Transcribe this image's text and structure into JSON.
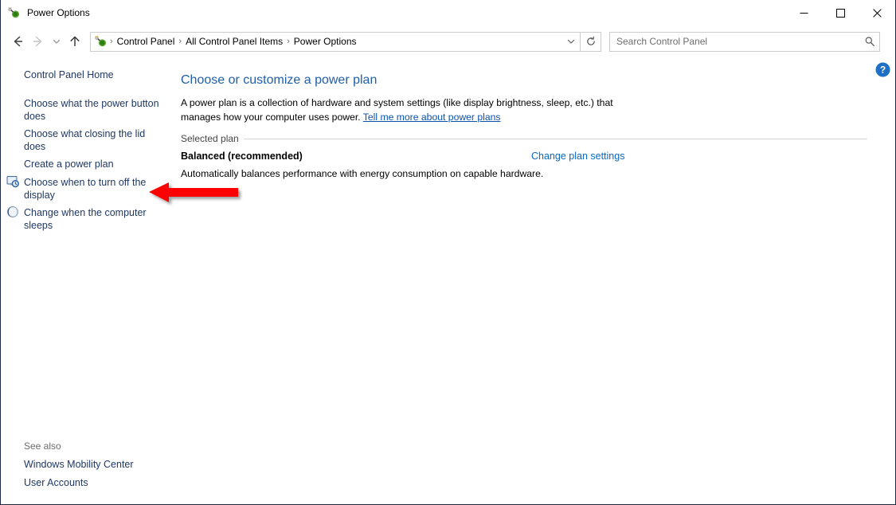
{
  "window": {
    "title": "Power Options",
    "icon": "power-plug-icon",
    "controls": {
      "minimize": "minimize-button",
      "maximize": "maximize-button",
      "close": "close-button"
    }
  },
  "navbar": {
    "back": "back-button",
    "forward": "forward-button",
    "recent": "recent-locations-button",
    "up": "up-button",
    "breadcrumb": {
      "icon": "power-plug-icon",
      "items": [
        "Control Panel",
        "All Control Panel Items",
        "Power Options"
      ],
      "separator": "›",
      "dropdown": "address-dropdown-button"
    },
    "refresh": "refresh-button",
    "search": {
      "placeholder": "Search Control Panel",
      "value": "",
      "icon": "search-icon"
    }
  },
  "sidebar": {
    "items": [
      {
        "label": "Control Panel Home",
        "icon": null
      },
      {
        "label": "Choose what the power button does",
        "icon": null
      },
      {
        "label": "Choose what closing the lid does",
        "icon": null
      },
      {
        "label": "Create a power plan",
        "icon": null
      },
      {
        "label": "Choose when to turn off the display",
        "icon": "display-clock-icon"
      },
      {
        "label": "Change when the computer sleeps",
        "icon": "sleep-moon-icon"
      }
    ],
    "see_also": {
      "label": "See also",
      "items": [
        "Windows Mobility Center",
        "User Accounts"
      ]
    }
  },
  "main": {
    "title": "Choose or customize a power plan",
    "description_part1": "A power plan is a collection of hardware and system settings (like display brightness, sleep, etc.) that manages how your computer uses power. ",
    "description_link": "Tell me more about power plans",
    "section_label": "Selected plan",
    "plan": {
      "name": "Balanced (recommended)",
      "description": "Automatically balances performance with energy consumption on capable hardware.",
      "change_link": "Change plan settings"
    },
    "help": "help-button"
  },
  "annotation": {
    "arrow": "red-left-arrow",
    "color": "#ff0000",
    "points_to": "Choose what closing the lid does"
  },
  "colors": {
    "link": "#1f3864",
    "heading": "#1f5fa9",
    "accent_link": "#0b67c4",
    "annotation": "#ff0000",
    "border": "#1b2a4a"
  }
}
